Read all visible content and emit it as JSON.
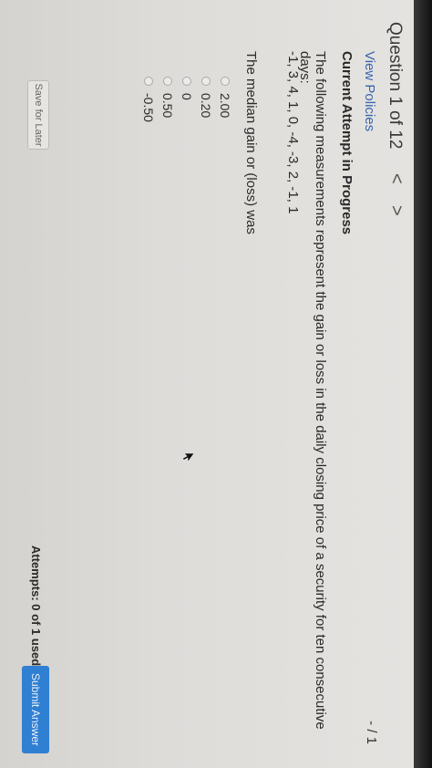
{
  "header": {
    "question_label": "Question 1 of 12",
    "prev_glyph": "<",
    "next_glyph": ">",
    "score": "- / 1"
  },
  "links": {
    "view_policies": "View Policies"
  },
  "status": {
    "attempt": "Current Attempt in Progress"
  },
  "question": {
    "text": "The following measurements represent the gain or loss in the daily closing price of a security for ten consecutive days:",
    "data": "-1, 3, 4, 1, 0, -4, -3, 2, -1, 1",
    "prompt": "The median gain or (loss) was"
  },
  "options": [
    {
      "label": "2.00"
    },
    {
      "label": "0.20"
    },
    {
      "label": "0"
    },
    {
      "label": "0.50"
    },
    {
      "label": "-0.50"
    }
  ],
  "footer": {
    "save_label": "Save for Later",
    "attempts_text": "Attempts: 0 of 1 used",
    "submit_label": "Submit Answer"
  },
  "colors": {
    "accent": "#2f7fd3",
    "link": "#3a63b0"
  },
  "icons": {
    "prev": "chevron-left-icon",
    "next": "chevron-right-icon",
    "radio": "radio-icon",
    "pointer": "mouse-pointer-icon"
  }
}
